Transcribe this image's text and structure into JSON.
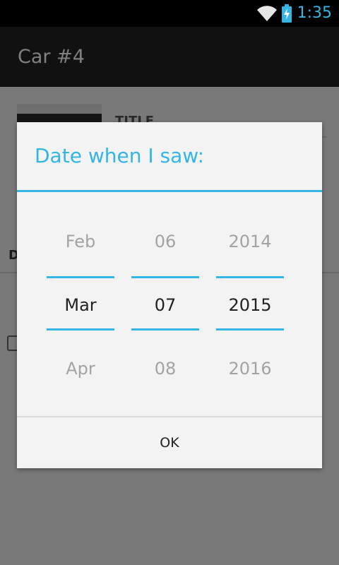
{
  "status_bar": {
    "time": "1:35",
    "icons": [
      "wifi-icon",
      "battery-charging-icon"
    ],
    "accent_color": "#33b5e5"
  },
  "action_bar": {
    "title": "Car #4"
  },
  "background": {
    "title_label": "TITLE",
    "section_label": "D"
  },
  "dialog": {
    "title": "Date when I saw:",
    "accent_color": "#33b5e5",
    "pickers": {
      "month": {
        "prev": "Feb",
        "current": "Mar",
        "next": "Apr"
      },
      "day": {
        "prev": "06",
        "current": "07",
        "next": "08"
      },
      "year": {
        "prev": "2014",
        "current": "2015",
        "next": "2016"
      }
    },
    "ok_label": "OK"
  }
}
